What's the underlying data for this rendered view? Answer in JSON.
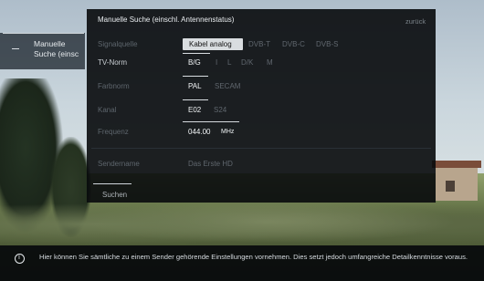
{
  "left_tab": {
    "label": "Manuelle Suche (einsc"
  },
  "panel": {
    "title": "Manuelle Suche (einschl. Antennenstatus)",
    "back": "zurück"
  },
  "rows": {
    "signalquelle": {
      "label": "Signalquelle",
      "options": [
        "Kabel analog",
        "DVB-T",
        "DVB-C",
        "DVB-S"
      ],
      "selected": "Kabel analog"
    },
    "tv_norm": {
      "label": "TV-Norm",
      "options": [
        "B/G",
        "I",
        "L",
        "D/K",
        "M"
      ],
      "selected": "B/G"
    },
    "farbnorm": {
      "label": "Farbnorm",
      "options": [
        "PAL",
        "SECAM"
      ],
      "selected": "PAL"
    },
    "kanal": {
      "label": "Kanal",
      "options": [
        "E02",
        "S24"
      ],
      "selected": "E02"
    },
    "frequenz": {
      "label": "Frequenz",
      "value": "044.00",
      "unit": "MHz"
    },
    "sendername": {
      "label": "Sendername",
      "value": "Das Erste HD"
    }
  },
  "search_button": "Suchen",
  "info": {
    "text": "Hier können Sie sämtliche zu einem Sender gehörende Einstellungen vornehmen. Dies setzt jedoch umfangreiche Detailkenntnisse voraus."
  },
  "colors": {
    "panel_bg": "#0a0c0e",
    "selected_text": "#f1f4f6",
    "dim_text": "#60676e"
  }
}
